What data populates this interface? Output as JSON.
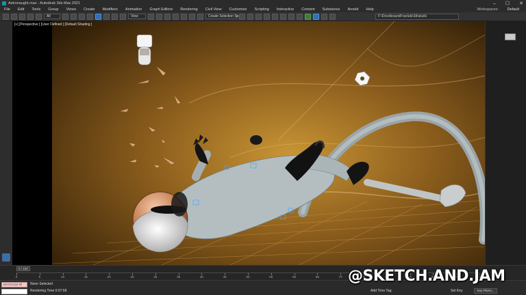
{
  "window": {
    "title": "Astronaught.max - Autodesk 3ds Max 2021",
    "controls": [
      "–",
      "☐",
      "✕"
    ]
  },
  "menubar": {
    "items": [
      "File",
      "Edit",
      "Tools",
      "Group",
      "Views",
      "Create",
      "Modifiers",
      "Animation",
      "Graph Editors",
      "Rendering",
      "Civil View",
      "Customize",
      "Scripting",
      "Interactive",
      "Content",
      "Substance",
      "Arnold",
      "Help"
    ],
    "workspaces_label": "Workspaces:",
    "workspaces_value": "Default"
  },
  "toolbar": {
    "selection_filter": "All",
    "reference_coord": "View",
    "selection_set": "Create Selection Se",
    "project_path": "F:\\DoodlesandFractals\\3d\\skulls"
  },
  "viewport": {
    "label": "[+] [Perspective ] [User Defined ] [Default Shading ]"
  },
  "timeline": {
    "time_slider": "0 / 100",
    "ticks": [
      "0",
      "5",
      "10",
      "15",
      "20",
      "25",
      "30",
      "35",
      "40",
      "45",
      "50",
      "55",
      "60",
      "65",
      "70",
      "75",
      "80",
      "85",
      "90",
      "95",
      "100"
    ]
  },
  "statusbar": {
    "maxscript_label": "MAXScript Mi",
    "selection": "None Selected",
    "render_time": "Rendering Time 0:07:58",
    "add_time_tag": "Add Time Tag",
    "set_key": "Set Key",
    "key_filters": "Key Filters..."
  },
  "watermark": "@SKETCH.AND.JAM",
  "colors": {
    "accent_blue": "#2f6fb4",
    "background_dark": "#1e1e1e",
    "scene_amber": "#b8862c"
  },
  "icons": [
    "undo-icon",
    "redo-icon",
    "link-icon",
    "unlink-icon",
    "bind-space-warp-icon",
    "select-icon",
    "select-by-name-icon",
    "rectangle-select-icon",
    "window-crossing-icon",
    "move-icon",
    "rotate-icon",
    "scale-icon",
    "pivot-icon",
    "snap-icon",
    "angle-snap-icon",
    "percent-snap-icon",
    "spinner-snap-icon",
    "mirror-icon",
    "align-icon",
    "scene-explorer-icon",
    "layer-explorer-icon",
    "curve-editor-icon",
    "schematic-view-icon",
    "material-editor-icon",
    "render-setup-icon",
    "render-frame-icon",
    "render-icon"
  ]
}
